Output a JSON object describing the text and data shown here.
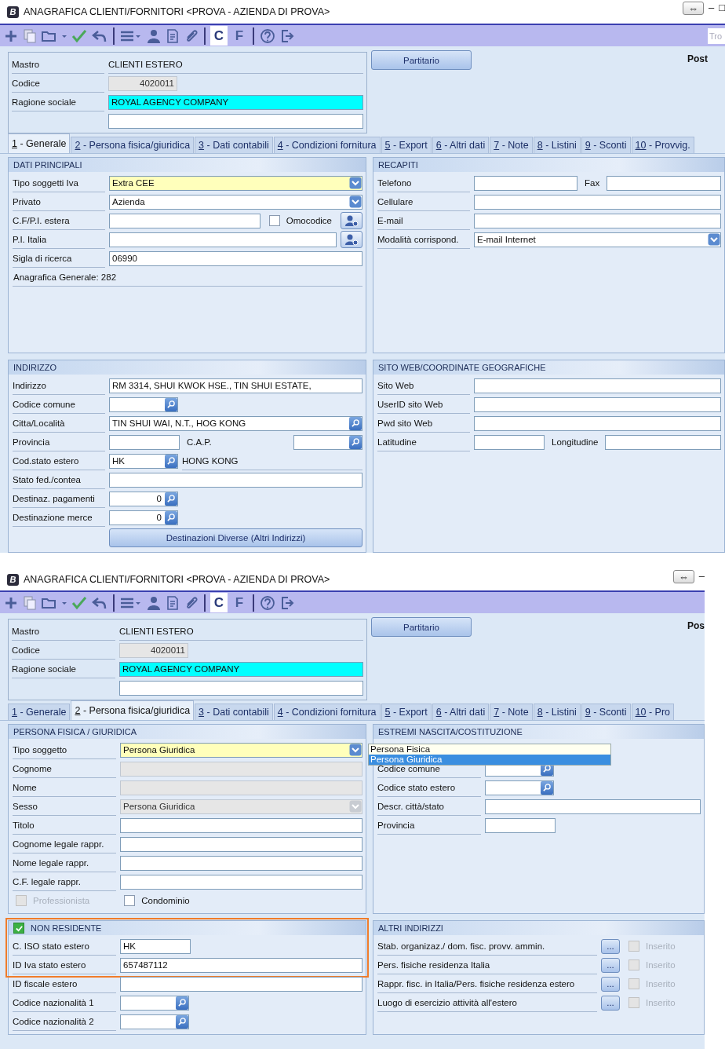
{
  "windows": [
    {
      "title": "ANAGRAFICA CLIENTI/FORNITORI <PROVA - AZIENDA DI PROVA>",
      "logo": "B",
      "window_controls": [
        "⇔",
        "–",
        "□"
      ],
      "toolbar": {
        "text_buttons": [
          {
            "label": "C",
            "selected": true
          },
          {
            "label": "F",
            "selected": false
          }
        ],
        "search": {
          "placeholder": "Tro"
        }
      },
      "header": {
        "rows": [
          {
            "label": "Mastro",
            "controls": [
              {
                "kind": "value-text",
                "value": "CLIENTI ESTERO"
              }
            ]
          },
          {
            "label": "Codice",
            "controls": [
              {
                "kind": "number-field",
                "value": "4020011",
                "disabled": true
              }
            ]
          },
          {
            "label": "Ragione sociale",
            "controls": [
              {
                "kind": "field",
                "value": "ROYAL AGENCY COMPANY",
                "highlighted": true
              }
            ]
          },
          {
            "controls": [
              {
                "kind": "field"
              }
            ]
          }
        ],
        "button": "Partitario",
        "post": "Post"
      },
      "tabs": [
        {
          "key": "1",
          "label": " - Generale",
          "selected": true
        },
        {
          "key": "2",
          "label": " - Persona fisica/giuridica",
          "selected": false
        },
        {
          "key": "3",
          "label": " - Dati contabili",
          "selected": false
        },
        {
          "key": "4",
          "label": " - Condizioni fornitura",
          "selected": false
        },
        {
          "key": "5",
          "label": " - Export",
          "selected": false
        },
        {
          "key": "6",
          "label": " - Altri dati",
          "selected": false
        },
        {
          "key": "7",
          "label": " - Note",
          "selected": false
        },
        {
          "key": "8",
          "label": " - Listini",
          "selected": false
        },
        {
          "key": "9",
          "label": " - Sconti",
          "selected": false
        },
        {
          "key": "10",
          "label": " - Provvig.",
          "selected": false
        }
      ],
      "panels": [
        {
          "title": "DATI PRINCIPALI",
          "rows": [
            {
              "label": "Tipo soggetti Iva",
              "controls": [
                {
                  "kind": "select",
                  "value": "Extra CEE",
                  "focused": true
                }
              ]
            },
            {
              "label": "Privato",
              "controls": [
                {
                  "kind": "select",
                  "value": "Azienda"
                }
              ]
            },
            {
              "label": "C.F/P.I. estera",
              "controls": [
                {
                  "kind": "field"
                },
                {
                  "kind": "checkbox",
                  "label": "Omocodice",
                  "checked": false
                },
                {
                  "kind": "person-button"
                }
              ]
            },
            {
              "label": "P.I. Italia",
              "controls": [
                {
                  "kind": "field"
                },
                {
                  "kind": "person-button"
                }
              ]
            },
            {
              "label": "Sigla di ricerca",
              "controls": [
                {
                  "kind": "field",
                  "value": "06990"
                }
              ]
            },
            {
              "kind": "note",
              "text": "Anagrafica Generale: 282"
            }
          ]
        },
        {
          "title": "RECAPITI",
          "rows": [
            {
              "label": "Telefono",
              "controls": [
                {
                  "kind": "medium-field"
                },
                {
                  "kind": "inline-label",
                  "text": "Fax"
                },
                {
                  "kind": "field"
                }
              ]
            },
            {
              "label": "Cellulare",
              "controls": [
                {
                  "kind": "field"
                }
              ]
            },
            {
              "label": "E-mail",
              "controls": [
                {
                  "kind": "field"
                }
              ]
            },
            {
              "label": "Modalità corrispond.",
              "controls": [
                {
                  "kind": "select",
                  "value": "E-mail Internet"
                }
              ]
            }
          ]
        },
        {
          "title": "INDIRIZZO",
          "rows": [
            {
              "label": "Indirizzo",
              "controls": [
                {
                  "kind": "field",
                  "value": "RM 3314, SHUI KWOK HSE., TIN SHUI ESTATE,"
                }
              ]
            },
            {
              "label": "Codice comune",
              "controls": [
                {
                  "kind": "lookup"
                }
              ]
            },
            {
              "label": "Citta/Località",
              "controls": [
                {
                  "kind": "wide-lookup",
                  "value": "TIN SHUI WAI, N.T., HOG KONG"
                }
              ]
            },
            {
              "label": "Provincia",
              "controls": [
                {
                  "kind": "short-field"
                },
                {
                  "kind": "grow-label",
                  "text": "C.A.P."
                },
                {
                  "kind": "lookup"
                }
              ]
            },
            {
              "label": "Cod.stato estero",
              "controls": [
                {
                  "kind": "lookup",
                  "value": "HK"
                },
                {
                  "kind": "value-text",
                  "value": "HONG KONG"
                }
              ]
            },
            {
              "label": "Stato fed./contea",
              "controls": [
                {
                  "kind": "field"
                }
              ]
            },
            {
              "label": "Destinaz. pagamenti",
              "controls": [
                {
                  "kind": "number-lookup",
                  "value": "0"
                }
              ]
            },
            {
              "label": "Destinazione merce",
              "controls": [
                {
                  "kind": "number-lookup",
                  "value": "0"
                }
              ]
            },
            {
              "kind": "button-row",
              "button": "Destinazioni Diverse (Altri Indirizzi)"
            }
          ]
        },
        {
          "title": "SITO WEB/COORDINATE GEOGRAFICHE",
          "rows": [
            {
              "label": "Sito Web",
              "controls": [
                {
                  "kind": "field"
                }
              ]
            },
            {
              "label": "UserID sito Web",
              "controls": [
                {
                  "kind": "field"
                }
              ]
            },
            {
              "label": "Pwd sito Web",
              "controls": [
                {
                  "kind": "field"
                }
              ]
            },
            {
              "label": "Latitudine",
              "controls": [
                {
                  "kind": "short-field"
                },
                {
                  "kind": "inline-label",
                  "text": "Longitudine"
                },
                {
                  "kind": "field"
                }
              ]
            }
          ]
        }
      ]
    },
    {
      "title": "ANAGRAFICA CLIENTI/FORNITORI <PROVA - AZIENDA DI PROVA>",
      "logo": "B",
      "window_controls": [
        "⇔",
        "–"
      ],
      "toolbar": {
        "text_buttons": [
          {
            "label": "C",
            "selected": true
          },
          {
            "label": "F",
            "selected": false
          }
        ]
      },
      "header": {
        "rows": [
          {
            "label": "Mastro",
            "controls": [
              {
                "kind": "value-text",
                "value": "CLIENTI ESTERO"
              }
            ]
          },
          {
            "label": "Codice",
            "controls": [
              {
                "kind": "number-field",
                "value": "4020011",
                "disabled": true
              }
            ]
          },
          {
            "label": "Ragione sociale",
            "controls": [
              {
                "kind": "field",
                "value": "ROYAL AGENCY COMPANY",
                "highlighted": true
              }
            ]
          },
          {
            "controls": [
              {
                "kind": "field"
              }
            ]
          }
        ],
        "button": "Partitario",
        "post": "Pos"
      },
      "tabs": [
        {
          "key": "1",
          "label": " - Generale",
          "selected": false
        },
        {
          "key": "2",
          "label": " - Persona fisica/giuridica",
          "selected": true
        },
        {
          "key": "3",
          "label": " - Dati contabili",
          "selected": false
        },
        {
          "key": "4",
          "label": " - Condizioni fornitura",
          "selected": false
        },
        {
          "key": "5",
          "label": " - Export",
          "selected": false
        },
        {
          "key": "6",
          "label": " - Altri dati",
          "selected": false
        },
        {
          "key": "7",
          "label": " - Note",
          "selected": false
        },
        {
          "key": "8",
          "label": " - Listini",
          "selected": false
        },
        {
          "key": "9",
          "label": " - Sconti",
          "selected": false
        },
        {
          "key": "10",
          "label": " - Pro",
          "selected": false
        }
      ],
      "panels": [
        {
          "title": "PERSONA FISICA / GIURIDICA",
          "rows": [
            {
              "label": "Tipo soggetto",
              "controls": [
                {
                  "kind": "select",
                  "value": "Persona Giuridica",
                  "focused": true,
                  "options": [
                    {
                      "label": "Persona Fisica",
                      "selected": false
                    },
                    {
                      "label": "Persona Giuridica",
                      "selected": true
                    }
                  ]
                }
              ]
            },
            {
              "label": "Cognome",
              "controls": [
                {
                  "kind": "field",
                  "disabled": true
                }
              ]
            },
            {
              "label": "Nome",
              "controls": [
                {
                  "kind": "field",
                  "disabled": true
                }
              ]
            },
            {
              "label": "Sesso",
              "controls": [
                {
                  "kind": "select",
                  "value": "Persona Giuridica",
                  "disabled": true
                }
              ]
            },
            {
              "label": "Titolo",
              "controls": [
                {
                  "kind": "field"
                }
              ]
            },
            {
              "label": "Cognome legale rappr.",
              "controls": [
                {
                  "kind": "field"
                }
              ]
            },
            {
              "label": "Nome legale rappr.",
              "controls": [
                {
                  "kind": "field"
                }
              ]
            },
            {
              "label": "C.F. legale rappr.",
              "controls": [
                {
                  "kind": "field"
                }
              ]
            },
            {
              "kind": "checkboxes",
              "controls": [
                {
                  "kind": "checkbox",
                  "label": "Professionista",
                  "checked": false,
                  "disabled": true
                },
                {
                  "kind": "checkbox",
                  "label": "Condominio",
                  "checked": false
                }
              ]
            }
          ]
        },
        {
          "title": "ESTREMI NASCITA/COSTITUZIONE",
          "rows": [
            {
              "kind": "covered"
            },
            {
              "label": "Codice comune",
              "controls": [
                {
                  "kind": "lookup"
                }
              ]
            },
            {
              "label": "Codice stato estero",
              "controls": [
                {
                  "kind": "lookup"
                }
              ]
            },
            {
              "label": "Descr. città/stato",
              "controls": [
                {
                  "kind": "field"
                }
              ]
            },
            {
              "label": "Provincia",
              "controls": [
                {
                  "kind": "short-field"
                }
              ]
            }
          ]
        },
        {
          "title": "NON RESIDENTE",
          "checked": true,
          "highlighted": true,
          "rows": [
            {
              "label": "C. ISO stato estero",
              "controls": [
                {
                  "kind": "short-field",
                  "value": "HK"
                }
              ]
            },
            {
              "label": "ID Iva stato estero",
              "controls": [
                {
                  "kind": "field",
                  "value": "657487112"
                }
              ]
            },
            {
              "label": "ID fiscale estero",
              "controls": [
                {
                  "kind": "field"
                }
              ]
            },
            {
              "label": "Codice nazionalità 1",
              "controls": [
                {
                  "kind": "lookup"
                }
              ]
            },
            {
              "label": "Codice nazionalità 2",
              "controls": [
                {
                  "kind": "lookup"
                }
              ]
            }
          ]
        },
        {
          "title": "ALTRI INDIRIZZI",
          "kind": "links",
          "rows": [
            {
              "label": "Stab. organizaz./ dom. fisc. provv. ammin.",
              "controls": [
                {
                  "kind": "dots-button",
                  "label": "..."
                },
                {
                  "kind": "checkbox",
                  "label": "Inserito",
                  "checked": false,
                  "disabled": true
                }
              ]
            },
            {
              "label": "Pers. fisiche residenza Italia",
              "controls": [
                {
                  "kind": "dots-button",
                  "label": "..."
                },
                {
                  "kind": "checkbox",
                  "label": "Inserito",
                  "checked": false,
                  "disabled": true
                }
              ]
            },
            {
              "label": "Rappr. fisc. in Italia/Pers. fisiche residenza estero",
              "controls": [
                {
                  "kind": "dots-button",
                  "label": "..."
                },
                {
                  "kind": "checkbox",
                  "label": "Inserito",
                  "checked": false,
                  "disabled": true
                }
              ]
            },
            {
              "label": "Luogo di esercizio attività all'estero",
              "controls": [
                {
                  "kind": "dots-button",
                  "label": "..."
                },
                {
                  "kind": "checkbox",
                  "label": "Inserito",
                  "checked": false,
                  "disabled": true
                }
              ]
            }
          ]
        }
      ]
    }
  ]
}
